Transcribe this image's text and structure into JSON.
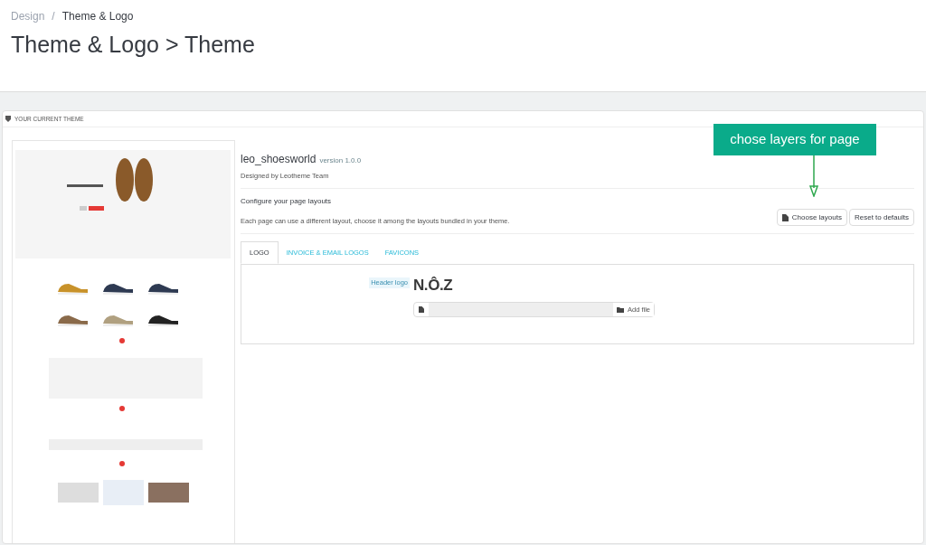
{
  "breadcrumb": [
    {
      "label": "Design",
      "current": false
    },
    {
      "label": "Theme & Logo",
      "current": true
    }
  ],
  "breadcrumb_separator": "/",
  "page_title": "Theme & Logo > Theme",
  "panel": {
    "title": "YOUR CURRENT THEME",
    "theme": {
      "name": "leo_shoesworld",
      "version": "version 1.0.0",
      "author": "Designed by Leotheme Team"
    },
    "layouts": {
      "heading": "Configure your page layouts",
      "description": "Each page can use a different layout, choose it among the layouts bundled in your theme.",
      "buttons": [
        {
          "label": "Choose layouts",
          "kind": "file"
        },
        {
          "label": "Reset to defaults",
          "kind": "plain"
        }
      ]
    },
    "tabs": [
      {
        "label": "LOGO",
        "selected": true
      },
      {
        "label": "INVOICE & EMAIL LOGOS",
        "selected": false
      },
      {
        "label": "FAVICONS",
        "selected": false
      }
    ],
    "logo_field": {
      "label": "Header logo",
      "logo": "N.Ô.Z",
      "button": "Add file"
    }
  },
  "callout": {
    "text": "chose layers for page"
  }
}
